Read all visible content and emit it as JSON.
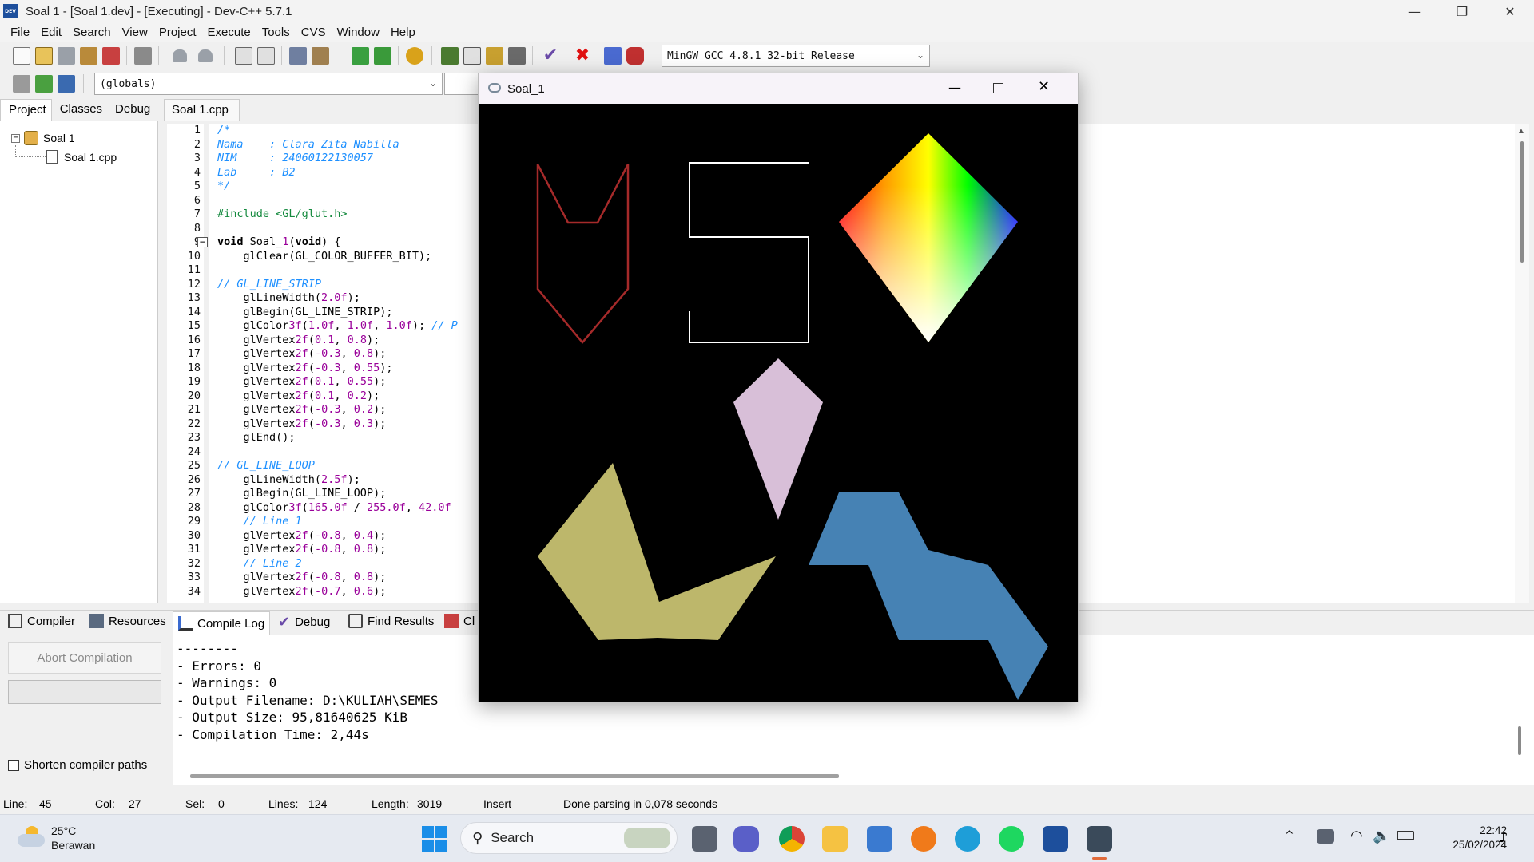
{
  "window": {
    "title": "Soal 1 - [Soal 1.dev] - [Executing] - Dev-C++ 5.7.1",
    "app_icon_text": "DEV"
  },
  "menu": [
    "File",
    "Edit",
    "Search",
    "View",
    "Project",
    "Execute",
    "Tools",
    "CVS",
    "Window",
    "Help"
  ],
  "toolbar": {
    "compiler_select": "MinGW GCC 4.8.1 32-bit Release",
    "scope_select": "(globals)"
  },
  "left_panel": {
    "tabs": [
      "Project",
      "Classes",
      "Debug"
    ],
    "project_name": "Soal 1",
    "file_name": "Soal 1.cpp"
  },
  "editor": {
    "tab_label": "Soal 1.cpp",
    "line_numbers": [
      "1",
      "2",
      "3",
      "4",
      "5",
      "6",
      "7",
      "8",
      "9",
      "10",
      "11",
      "12",
      "13",
      "14",
      "15",
      "16",
      "17",
      "18",
      "19",
      "20",
      "21",
      "22",
      "23",
      "24",
      "25",
      "26",
      "27",
      "28",
      "29",
      "30",
      "31",
      "32",
      "33",
      "34"
    ],
    "lines": [
      "/*",
      "Nama    : Clara Zita Nabilla",
      "NIM     : 24060122130057",
      "Lab     : B2",
      "*/",
      "",
      "#include <GL/glut.h>",
      "",
      "void Soal_1(void) {",
      "    glClear(GL_COLOR_BUFFER_BIT);",
      "",
      "// GL_LINE_STRIP",
      "    glLineWidth(2.0f);",
      "    glBegin(GL_LINE_STRIP);",
      "    glColor3f(1.0f, 1.0f, 1.0f); // P",
      "    glVertex2f(0.1, 0.8);",
      "    glVertex2f(-0.3, 0.8);",
      "    glVertex2f(-0.3, 0.55);",
      "    glVertex2f(0.1, 0.55);",
      "    glVertex2f(0.1, 0.2);",
      "    glVertex2f(-0.3, 0.2);",
      "    glVertex2f(-0.3, 0.3);",
      "    glEnd();",
      "",
      "// GL_LINE_LOOP",
      "    glLineWidth(2.5f);",
      "    glBegin(GL_LINE_LOOP);",
      "    glColor3f(165.0f / 255.0f, 42.0f",
      "    // Line 1",
      "    glVertex2f(-0.8, 0.4);",
      "    glVertex2f(-0.8, 0.8);",
      "    // Line 2",
      "    glVertex2f(-0.8, 0.8);",
      "    glVertex2f(-0.7, 0.6);"
    ]
  },
  "bottom_panel": {
    "tabs": [
      "Compiler",
      "Resources",
      "Compile Log",
      "Debug",
      "Find Results",
      "Cl"
    ],
    "active_tab": "Compile Log",
    "abort_label": "Abort Compilation",
    "shorten_label": "Shorten compiler paths",
    "log_lines": [
      "--------",
      "- Errors: 0",
      "- Warnings: 0",
      "- Output Filename: D:\\KULIAH\\SEMES",
      "- Output Size: 95,81640625 KiB",
      "- Compilation Time: 2,44s"
    ]
  },
  "status": {
    "line_label": "Line:",
    "line_value": "45",
    "col_label": "Col:",
    "col_value": "27",
    "sel_label": "Sel:",
    "sel_value": "0",
    "lines_label": "Lines:",
    "lines_value": "124",
    "length_label": "Length:",
    "length_value": "3019",
    "mode": "Insert",
    "message": "Done parsing in 0,078 seconds"
  },
  "output_window": {
    "title": "Soal_1"
  },
  "taskbar": {
    "weather_temp": "25°C",
    "weather_desc": "Berawan",
    "search_label": "Search",
    "time": "22:42",
    "date": "25/02/2024"
  },
  "colors": {
    "comment": "#1e90ff",
    "preprocessor": "#148a3e",
    "number": "#9a009a",
    "dark_red_shape": "#a52a2a",
    "white_shape": "#ffffff",
    "lilac_shape": "#d8bfd8",
    "crown_shape": "#bdb76b",
    "blue_shape": "#4682b4"
  }
}
